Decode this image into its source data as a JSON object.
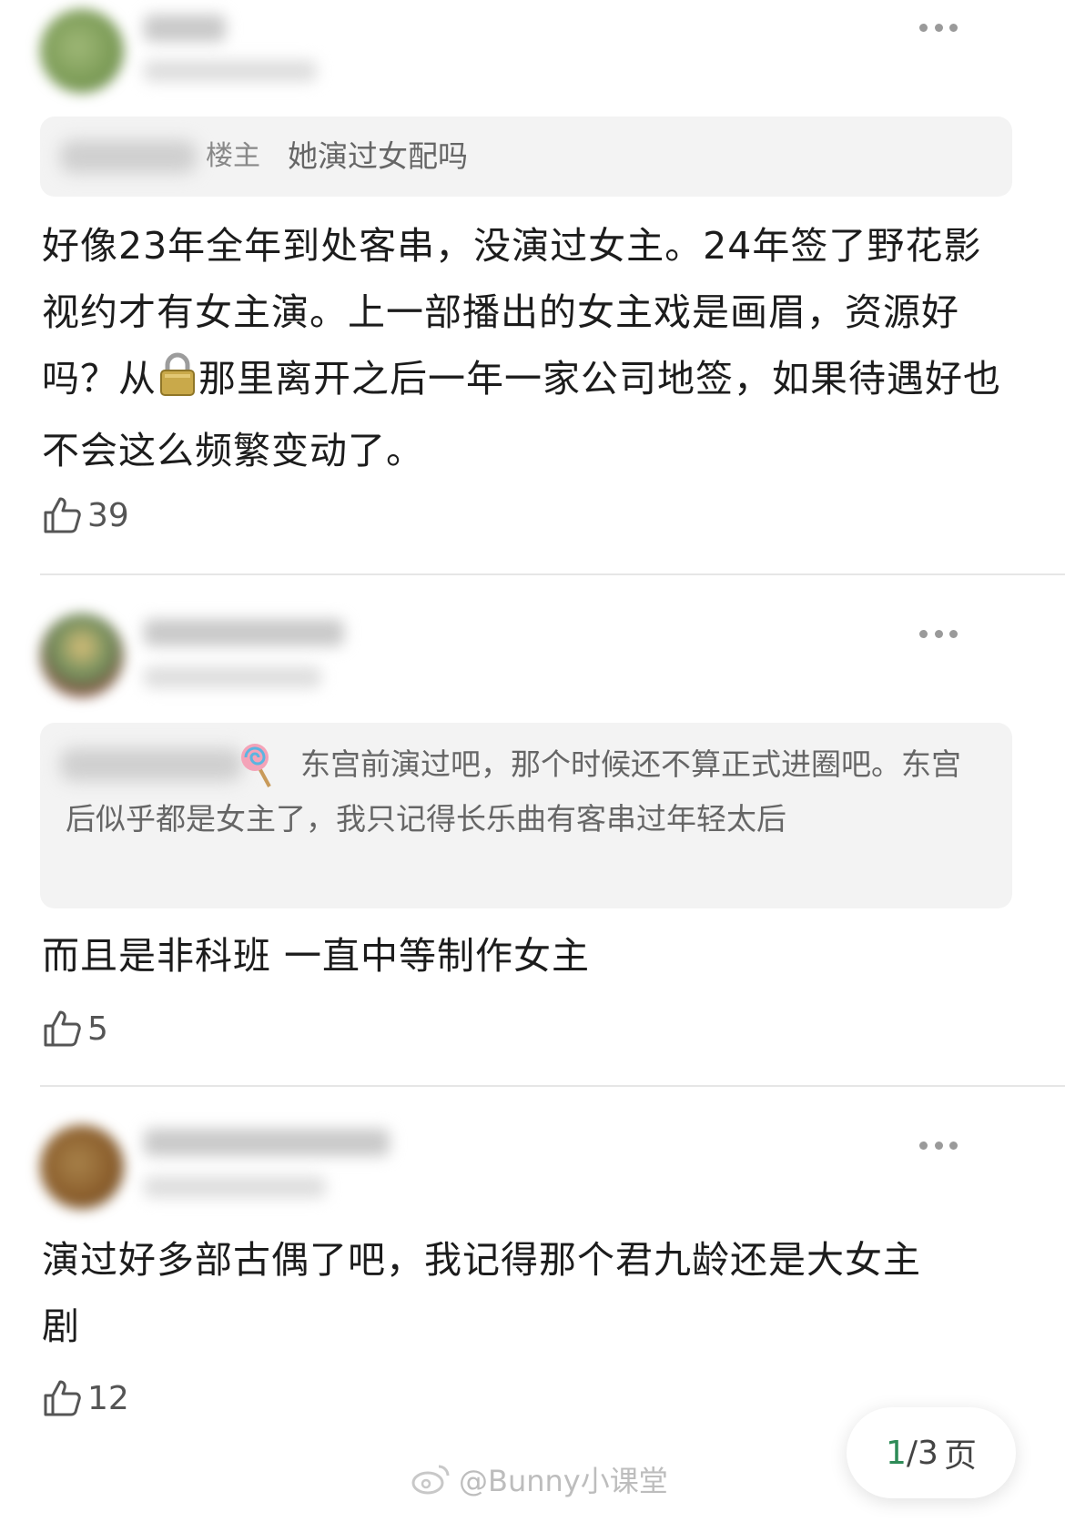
{
  "comments": [
    {
      "quote": {
        "op_label": "楼主",
        "text": "她演过女配吗"
      },
      "body": "好像23年全年到处客串，没演过女主。24年签了野花影视约才有女主演。上一部播出的女主戏是画眉，资源好吗？从",
      "body_after_icon": "那里离开之后一年一家公司地签，如果待遇好也不会这么频繁变动了。",
      "likes": "39"
    },
    {
      "quote": {
        "text": "东宫前演过吧，那个时候还不算正式进圈吧。东宫后似乎都是女主了，我只记得长乐曲有客串过年轻太后"
      },
      "body": "而且是非科班 一直中等制作女主",
      "likes": "5"
    },
    {
      "body": "演过好多部古偶了吧，我记得那个君九龄还是大女主剧",
      "likes": "12"
    }
  ],
  "pager": {
    "current": "1",
    "total": "/3",
    "unit": "页"
  },
  "watermark": "@Bunny小课堂",
  "colors": {
    "quote_bg": "#f3f3f3",
    "pager_current": "#2e8b57"
  },
  "icons": [
    "more-icon",
    "thumbs-up-icon",
    "lock-icon",
    "lollipop-icon",
    "weibo-logo-icon"
  ]
}
